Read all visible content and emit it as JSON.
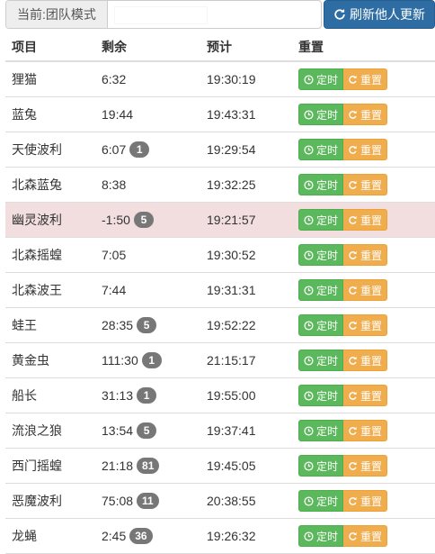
{
  "toolbar": {
    "mode_label": "当前:团队模式",
    "mode_input_value": "",
    "refresh_label": "刷新他人更新"
  },
  "table": {
    "headers": [
      "项目",
      "剩余",
      "预计",
      "重置"
    ],
    "timer_label": "定时",
    "reset_label": "重置",
    "rows": [
      {
        "name": "狸猫",
        "remaining": "6:32",
        "badge": "",
        "eta": "19:30:19",
        "highlight": false
      },
      {
        "name": "蓝兔",
        "remaining": "19:44",
        "badge": "",
        "eta": "19:43:31",
        "highlight": false
      },
      {
        "name": "天使波利",
        "remaining": "6:07",
        "badge": "1",
        "eta": "19:29:54",
        "highlight": false
      },
      {
        "name": "北森蓝兔",
        "remaining": "8:38",
        "badge": "",
        "eta": "19:32:25",
        "highlight": false
      },
      {
        "name": "幽灵波利",
        "remaining": "-1:50",
        "badge": "5",
        "eta": "19:21:57",
        "highlight": true
      },
      {
        "name": "北森摇蝗",
        "remaining": "7:05",
        "badge": "",
        "eta": "19:30:52",
        "highlight": false
      },
      {
        "name": "北森波王",
        "remaining": "7:44",
        "badge": "",
        "eta": "19:31:31",
        "highlight": false
      },
      {
        "name": "蛙王",
        "remaining": "28:35",
        "badge": "5",
        "eta": "19:52:22",
        "highlight": false
      },
      {
        "name": "黄金虫",
        "remaining": "111:30",
        "badge": "1",
        "eta": "21:15:17",
        "highlight": false
      },
      {
        "name": "船长",
        "remaining": "31:13",
        "badge": "1",
        "eta": "19:55:00",
        "highlight": false
      },
      {
        "name": "流浪之狼",
        "remaining": "13:54",
        "badge": "5",
        "eta": "19:37:41",
        "highlight": false
      },
      {
        "name": "西门摇蝗",
        "remaining": "21:18",
        "badge": "81",
        "eta": "19:45:05",
        "highlight": false
      },
      {
        "name": "恶魔波利",
        "remaining": "75:08",
        "badge": "11",
        "eta": "20:38:55",
        "highlight": false
      },
      {
        "name": "龙蝇",
        "remaining": "2:45",
        "badge": "36",
        "eta": "19:26:32",
        "highlight": false
      }
    ]
  },
  "colors": {
    "primary": "#2e6da4",
    "success": "#5cb85c",
    "warning": "#f0ad4e",
    "danger_row": "#f2dede",
    "badge": "#777777"
  },
  "icons": {
    "refresh": "refresh-icon",
    "timer": "clock-icon",
    "reset": "reset-icon"
  }
}
